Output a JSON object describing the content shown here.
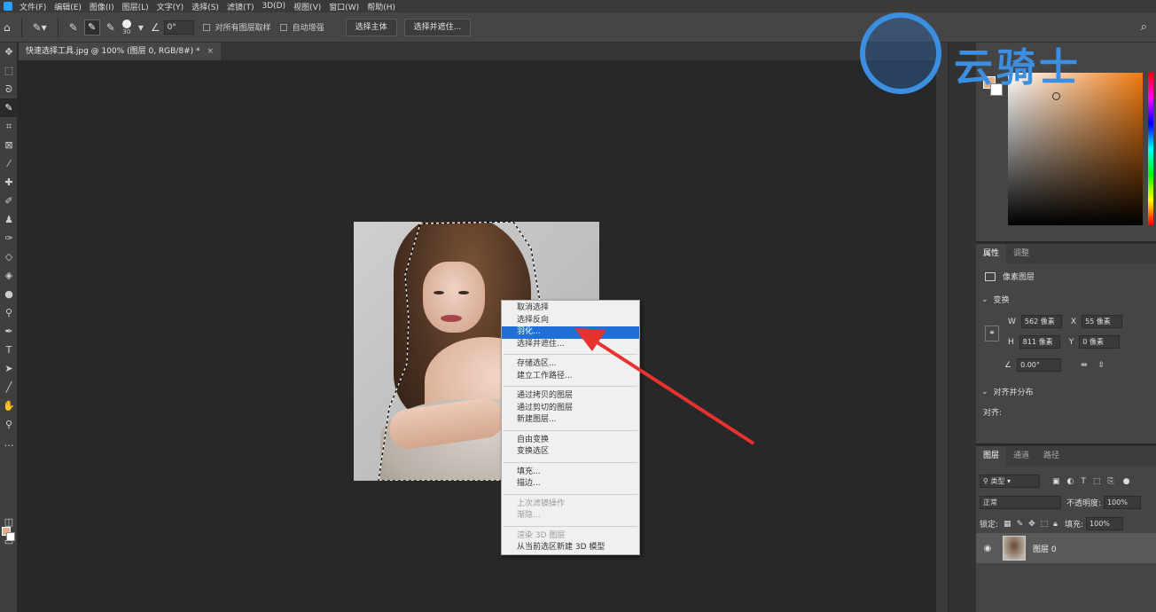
{
  "menubar": {
    "items": [
      "文件(F)",
      "编辑(E)",
      "图像(I)",
      "图层(L)",
      "文字(Y)",
      "选择(S)",
      "滤镜(T)",
      "3D(D)",
      "视图(V)",
      "窗口(W)",
      "帮助(H)"
    ]
  },
  "options": {
    "brush_size": "30",
    "angle": "0°",
    "sample_all_layers": "对所有图层取样",
    "auto_enhance": "自动增强",
    "select_subject": "选择主体",
    "select_and_mask": "选择并遮住..."
  },
  "document": {
    "tab_title": "快速选择工具.jpg @ 100% (图层 0, RGB/8#) *",
    "close": "×"
  },
  "context_menu": {
    "items": [
      {
        "label": "取消选择",
        "state": "normal"
      },
      {
        "label": "选择反向",
        "state": "normal"
      },
      {
        "label": "羽化...",
        "state": "selected"
      },
      {
        "label": "选择并遮住...",
        "state": "normal"
      },
      {
        "sep": true
      },
      {
        "label": "存储选区...",
        "state": "normal"
      },
      {
        "label": "建立工作路径...",
        "state": "normal"
      },
      {
        "sep": true
      },
      {
        "label": "通过拷贝的图层",
        "state": "normal"
      },
      {
        "label": "通过剪切的图层",
        "state": "normal"
      },
      {
        "label": "新建图层...",
        "state": "normal"
      },
      {
        "sep": true
      },
      {
        "label": "自由变换",
        "state": "normal"
      },
      {
        "label": "变换选区",
        "state": "normal"
      },
      {
        "sep": true
      },
      {
        "label": "填充...",
        "state": "normal"
      },
      {
        "label": "描边...",
        "state": "normal"
      },
      {
        "sep": true
      },
      {
        "label": "上次滤镜操作",
        "state": "disabled"
      },
      {
        "label": "渐隐...",
        "state": "disabled"
      },
      {
        "sep": true
      },
      {
        "label": "渲染 3D 图层",
        "state": "disabled"
      },
      {
        "label": "从当前选区新建 3D 模型",
        "state": "normal"
      }
    ]
  },
  "watermark": {
    "text": "云骑士"
  },
  "properties": {
    "tab_properties": "属性",
    "tab_adjust": "调整",
    "layer_type": "像素图层",
    "transform": "变换",
    "w_label": "W",
    "w_value": "562 像素",
    "x_label": "X",
    "x_value": "55 像素",
    "h_label": "H",
    "h_value": "811 像素",
    "y_label": "Y",
    "y_value": "0 像素",
    "angle_value": "0.00°",
    "align": "对齐并分布",
    "align_sub": "对齐:"
  },
  "layers": {
    "tab_layers": "图层",
    "tab_channels": "通道",
    "tab_paths": "路径",
    "kind": "类型",
    "blend_mode": "正常",
    "opacity_label": "不透明度:",
    "opacity_value": "100%",
    "lock_label": "锁定:",
    "fill_label": "填充:",
    "fill_value": "100%",
    "layer_name": "图层 0"
  },
  "colors": {
    "accent_selected": "#1f6fd6",
    "arrow": "#e8322f",
    "watermark": "#3c8ee0",
    "foreground": "#e0b08c"
  }
}
